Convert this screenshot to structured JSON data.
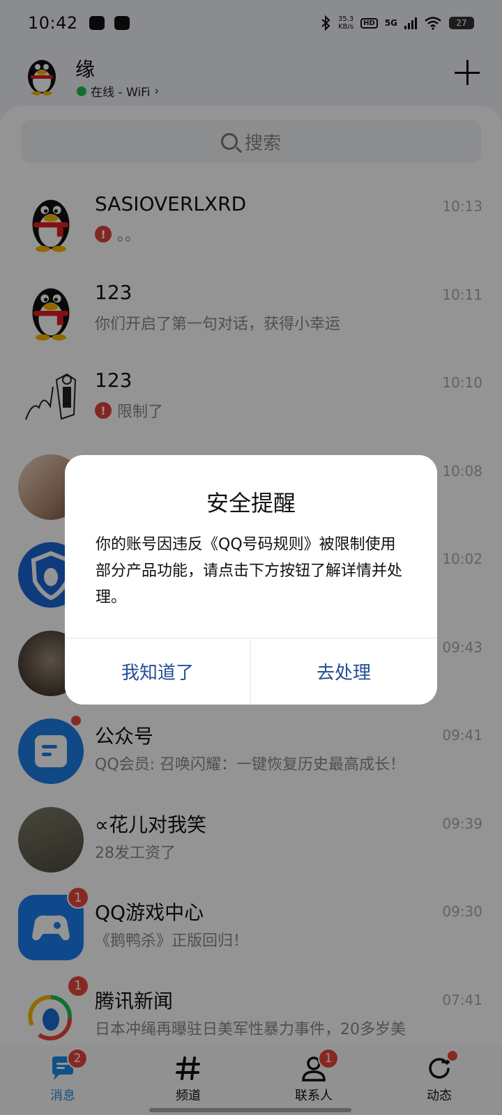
{
  "status_bar": {
    "time": "10:42",
    "net_speed_value": "35.3",
    "net_speed_unit": "KB/s",
    "hd": "HD",
    "network": "5G",
    "battery": "27"
  },
  "header": {
    "username": "缘",
    "status": "在线 - WiFi",
    "chevron": "›"
  },
  "search": {
    "placeholder": "搜索"
  },
  "conversations": [
    {
      "name": "SASIOVERLXRD",
      "preview": "。。",
      "time": "10:13",
      "warning": true
    },
    {
      "name": "123",
      "preview": "你们开启了第一句对话，获得小幸运",
      "time": "10:11"
    },
    {
      "name": "123",
      "preview": "限制了",
      "time": "10:10",
      "warning": true
    },
    {
      "name": "",
      "preview": "",
      "time": "10:08"
    },
    {
      "name": "",
      "preview": "",
      "time": "10:02"
    },
    {
      "name": "",
      "preview": "",
      "time": "09:43"
    },
    {
      "name": "公众号",
      "preview": "QQ会员: 召唤闪耀：一键恢复历史最高成长！",
      "time": "09:41",
      "dot": true
    },
    {
      "name": "∝花儿对我笑",
      "preview": "28发工资了",
      "time": "09:39"
    },
    {
      "name": "QQ游戏中心",
      "preview": "《鹅鸭杀》正版回归！",
      "time": "09:30",
      "badge": "1"
    },
    {
      "name": "腾讯新闻",
      "preview": "日本冲绳再曝驻日美军性暴力事件，20多岁美",
      "time": "07:41",
      "badge": "1"
    }
  ],
  "tabs": [
    {
      "label": "消息",
      "badge": "2",
      "icon": "chat-bubble-icon"
    },
    {
      "label": "频道",
      "icon": "hash-icon"
    },
    {
      "label": "联系人",
      "badge": "1",
      "icon": "contacts-icon"
    },
    {
      "label": "动态",
      "icon": "refresh-icon"
    }
  ],
  "dialog": {
    "title": "安全提醒",
    "body": "你的账号因违反《QQ号码规则》被限制使用部分产品功能，请点击下方按钮了解详情并处理。",
    "left_button": "我知道了",
    "right_button": "去处理"
  },
  "colors": {
    "accent_blue": "#1e8ae8",
    "dialog_button_text": "#244f96",
    "badge_red": "#e8473c",
    "online_green": "#1fbf5a"
  }
}
